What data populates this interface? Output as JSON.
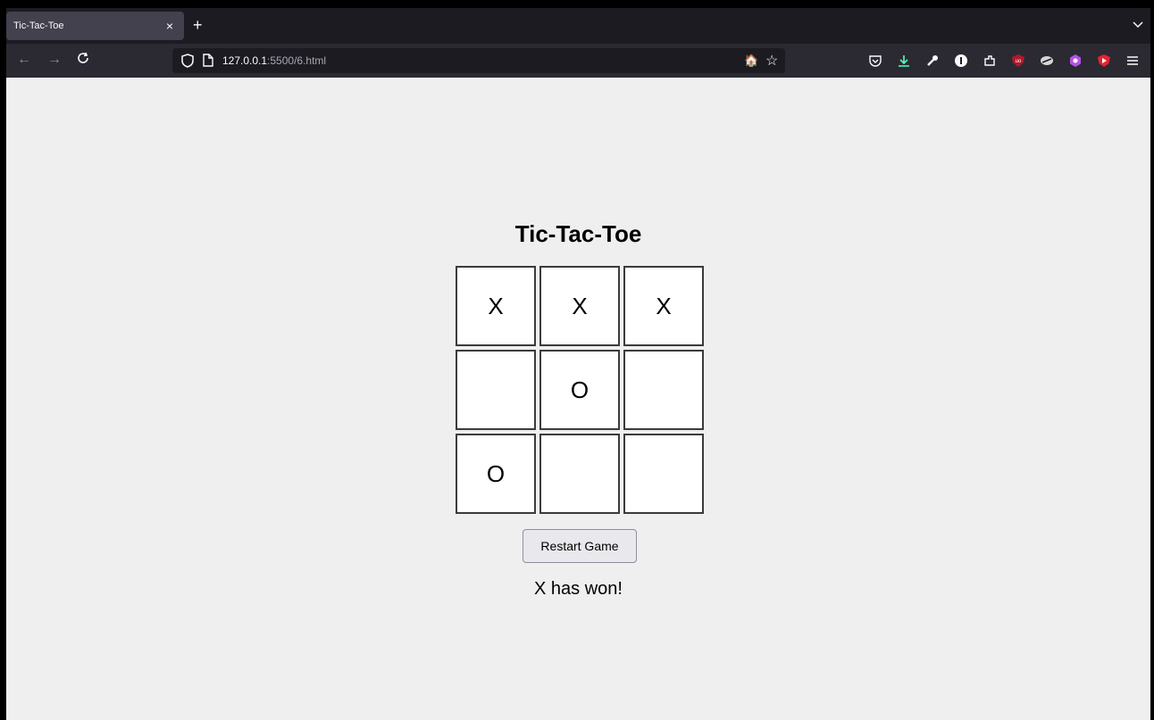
{
  "browser": {
    "tab": {
      "title": "Tic-Tac-Toe",
      "close": "×"
    },
    "new_tab": "+",
    "tab_list": "⌄",
    "nav": {
      "back": "←",
      "forward": "→",
      "reload": "C"
    },
    "url": {
      "host": "127.0.0.1",
      "rest": ":5500/6.html"
    },
    "toolbar_icons": [
      "pocket-icon",
      "download-icon",
      "wrench-icon",
      "onepassword-icon",
      "extensions-icon",
      "ublock-icon",
      "extension-icon",
      "extension-purple-icon",
      "extension-red-icon",
      "menu-icon"
    ]
  },
  "game": {
    "title": "Tic-Tac-Toe",
    "cells": [
      "X",
      "X",
      "X",
      "",
      "O",
      "",
      "O",
      "",
      ""
    ],
    "restart_label": "Restart Game",
    "status": "X has won!"
  },
  "colors": {
    "browser_dark": "#1c1b22",
    "toolbar": "#2b2a33",
    "page_bg": "#efefef",
    "cell_border": "#3b3b3b",
    "download_accent": "#54ffbd"
  }
}
